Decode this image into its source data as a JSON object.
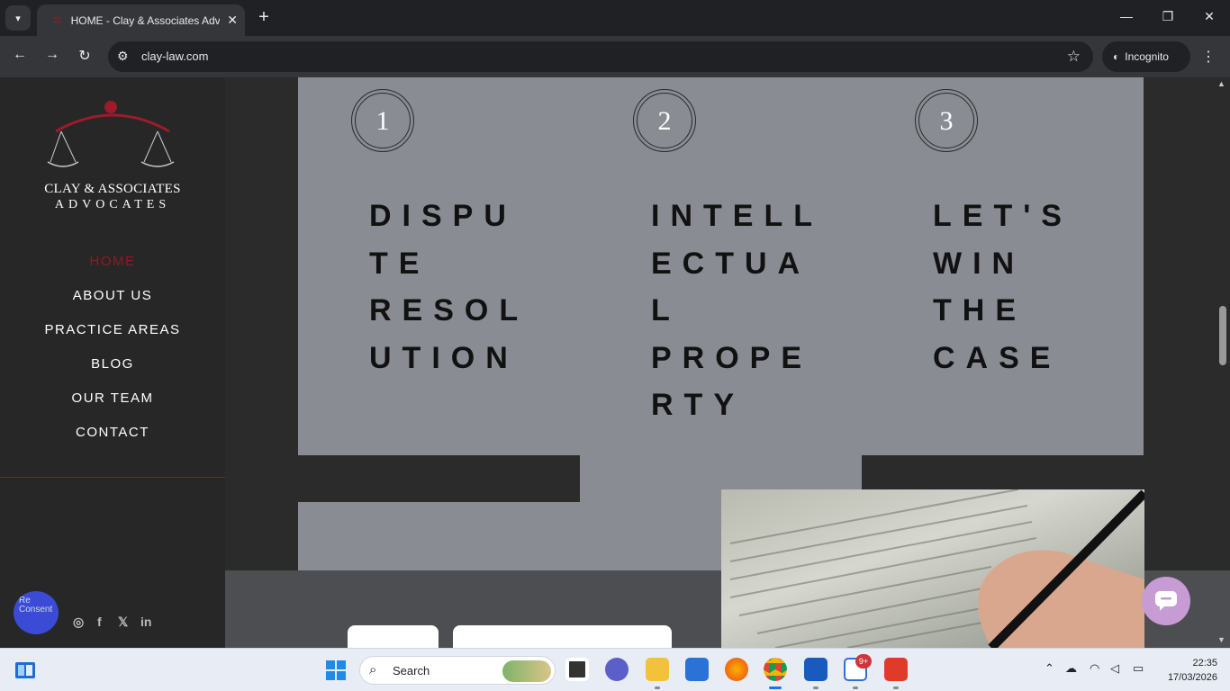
{
  "browser": {
    "tab_title": "HOME - Clay & Associates Adv",
    "tab_close": "✕",
    "new_tab": "+",
    "url": "clay-law.com",
    "incognito_label": "Incognito",
    "window_controls": {
      "minimize": "—",
      "restore": "❐",
      "close": "✕"
    }
  },
  "sidebar": {
    "logo_line1": "CLAY & ASSOCIATES",
    "logo_line2": "ADVOCATES",
    "nav": [
      {
        "label": "HOME",
        "active": true
      },
      {
        "label": "ABOUT US",
        "active": false
      },
      {
        "label": "PRACTICE AREAS",
        "active": false
      },
      {
        "label": "BLOG",
        "active": false
      },
      {
        "label": "OUR TEAM",
        "active": false
      },
      {
        "label": "CONTACT",
        "active": false
      }
    ],
    "recaptcha_alt": "Re Consent",
    "social_icons": [
      "whatsapp-icon",
      "facebook-icon",
      "x-icon",
      "linkedin-icon"
    ],
    "social_glyphs": {
      "whatsapp": "◎",
      "facebook": "f",
      "x": "𝕏",
      "linkedin": "in"
    }
  },
  "main": {
    "steps": [
      {
        "number": "1",
        "title": "DISPU\nTE\nRESOL\nUTION"
      },
      {
        "number": "2",
        "title": "INTELL\nECTUA\nL\nPROPE\nRTY"
      },
      {
        "number": "3",
        "title": "LET'S\nWIN\nTHE\nCASE"
      }
    ]
  },
  "colors": {
    "accent": "#8b1c26",
    "panel_grey": "#8a8c93",
    "page_dark": "#2b2b2b",
    "chat_button": "#c79bd4"
  },
  "taskbar": {
    "search_label": "Search",
    "mail_badge": "9+",
    "time": "22:35",
    "date": "17/03/2026"
  }
}
